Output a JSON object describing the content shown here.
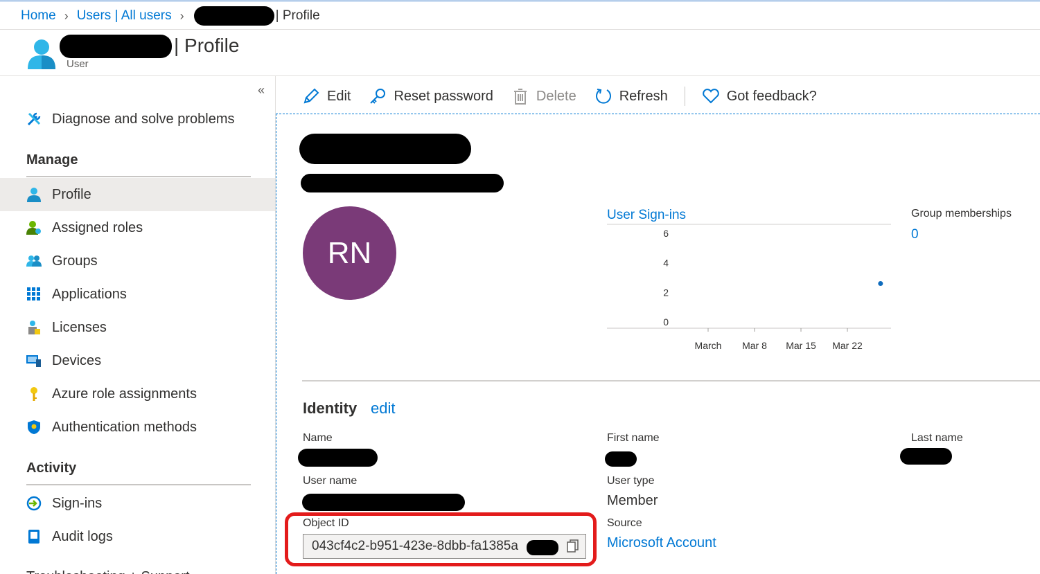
{
  "breadcrumb": {
    "home": "Home",
    "users": "Users | All users",
    "current": "| Profile"
  },
  "header": {
    "title": "| Profile",
    "subtitle": "User"
  },
  "sidebar": {
    "top_items": [
      {
        "label": "Diagnose and solve problems",
        "icon": "wrench-screwdriver-icon"
      }
    ],
    "manage_heading": "Manage",
    "manage_items": [
      {
        "label": "Profile",
        "icon": "user-icon",
        "active": true
      },
      {
        "label": "Assigned roles",
        "icon": "user-role-icon"
      },
      {
        "label": "Groups",
        "icon": "group-icon"
      },
      {
        "label": "Applications",
        "icon": "apps-grid-icon"
      },
      {
        "label": "Licenses",
        "icon": "license-icon"
      },
      {
        "label": "Devices",
        "icon": "devices-icon"
      },
      {
        "label": "Azure role assignments",
        "icon": "key-icon"
      },
      {
        "label": "Authentication methods",
        "icon": "shield-icon"
      }
    ],
    "activity_heading": "Activity",
    "activity_items": [
      {
        "label": "Sign-ins",
        "icon": "sign-in-icon"
      },
      {
        "label": "Audit logs",
        "icon": "audit-log-icon"
      }
    ],
    "cut_item": "Troubleshooting + Support"
  },
  "toolbar": {
    "edit": "Edit",
    "reset_password": "Reset password",
    "delete": "Delete",
    "refresh": "Refresh",
    "feedback": "Got feedback?"
  },
  "profile": {
    "initials": "RN",
    "avatar_color": "#7a3a78"
  },
  "chart_data": {
    "type": "scatter",
    "title": "User Sign-ins",
    "x_ticks": [
      "March",
      "Mar 8",
      "Mar 15",
      "Mar 22"
    ],
    "y_ticks": [
      0,
      2,
      4,
      6
    ],
    "ylim": [
      0,
      6
    ],
    "points": [
      {
        "x": "Mar 27",
        "y": 2.6
      }
    ],
    "grid": false,
    "color": "#0f6cbd"
  },
  "group_memberships": {
    "label": "Group memberships",
    "value": "0"
  },
  "identity": {
    "title": "Identity",
    "edit": "edit",
    "name_label": "Name",
    "first_name_label": "First name",
    "last_name_label": "Last name",
    "user_name_label": "User name",
    "user_type_label": "User type",
    "user_type_value": "Member",
    "object_id_label": "Object ID",
    "object_id_value": "043cf4c2-b951-423e-8dbb-fa1385a",
    "source_label": "Source",
    "source_value": "Microsoft Account"
  },
  "colors": {
    "accent": "#0078d4",
    "highlight_outline": "#e31b1b"
  }
}
